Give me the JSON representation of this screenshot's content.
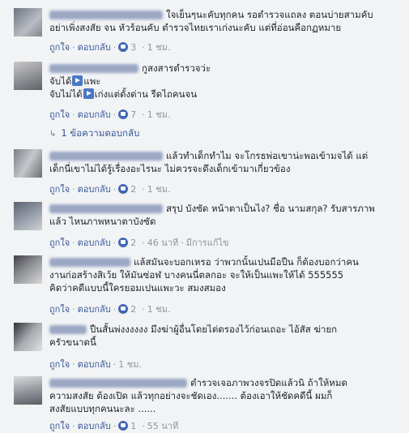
{
  "comments": [
    {
      "lines": [
        "ใจเย็นๆนะคับทุกคน รอตำรวจแถลง ตอนบ่ายสามคับ",
        "อย่าเพิ่งสงสัย จน หัวร้อนคับ ตำรวจไทยเราเก่งนะคับ แต่ที่อ่อนคือกฏหมาย"
      ],
      "like": "ถูกใจ",
      "reply": "ตอบกลับ",
      "count": "3",
      "time": "1 ชม."
    },
    {
      "lines": [
        "กูสงสารตำรวจว่ะ",
        "จับได้ แพะ",
        "จับไม่ได้ เก่งแต่ตั้งด่าน รีดไถคนจน"
      ],
      "like": "ถูกใจ",
      "reply": "ตอบกลับ",
      "count": "7",
      "time": "1 ชม.",
      "replies": "1 ข้อความตอบกลับ"
    },
    {
      "lines": [
        "แล้วทำเด็กทำไม จะโกรธพ่อเขาน่ะพอเข้ามจได้ แต่",
        "เด็กนี่เขาไม่ได้รู้เรื่องอะไรนะ ไม่ควรจะดึงเด็กเข้ามาเกี่ยวข้อง"
      ],
      "like": "ถูกใจ",
      "reply": "ตอบกลับ",
      "count": "2",
      "time": "1 ชม."
    },
    {
      "lines": [
        "สรุป บังซัด หน้าตาเป็นไง? ชื่อ นามสกุล? รับสารภาพ",
        "แล้ว ไหนภาพหนาตาบังซัด"
      ],
      "like": "ถูกใจ",
      "reply": "ตอบกลับ",
      "count": "2",
      "time": "46 นาที",
      "edited": "มีการแก้ไข"
    },
    {
      "lines": [
        "แล้สมันจะบอกเหรอ ว่าพวกนั้นเปนมือปืน ก็ต้องบอกว่าคน",
        "งานก่อสร้างสิเว้ย ให้มันซ่อฬ บางคนนี่ตลกอะ จะให้เป็นแพะให้ได้ 555555",
        "คิดว่าคดีแบบนี้ใครยอมเปนแพะวะ สมงสมอง"
      ],
      "like": "ถูกใจ",
      "reply": "ตอบกลับ",
      "count": "2",
      "time": "1 ชม."
    },
    {
      "lines": [
        "ปืนสั้นพ่งงงงงง มึงฆ่าผู้อื่นโดยไต่ตรองไว้ก่อนเถอะ ไอ้สัส ฆ่ายก",
        "ครัวขนาดนี้"
      ],
      "like": "ถูกใจ",
      "reply": "ตอบกลับ",
      "time": "1 ชม."
    },
    {
      "lines": [
        "ตำรวจเจอภาพวงจรปิดแล้วนิ ถ้าให้หมด",
        "ความสงสัย ต้องเปิด แล้วทุกอย่างจะชัดเอง....... ต้องเอาให้ชัดคดีนี้ ผมก็",
        "สงสัยแบบทุกคนนะละ ......"
      ],
      "like": "ถูกใจ",
      "reply": "ตอบกลับ",
      "count": "1",
      "time": "55 นาที"
    }
  ],
  "colors": {
    "link": "#365899",
    "meta": "#90949c",
    "like": "#4267b2",
    "bg": "#f2f3f5"
  }
}
